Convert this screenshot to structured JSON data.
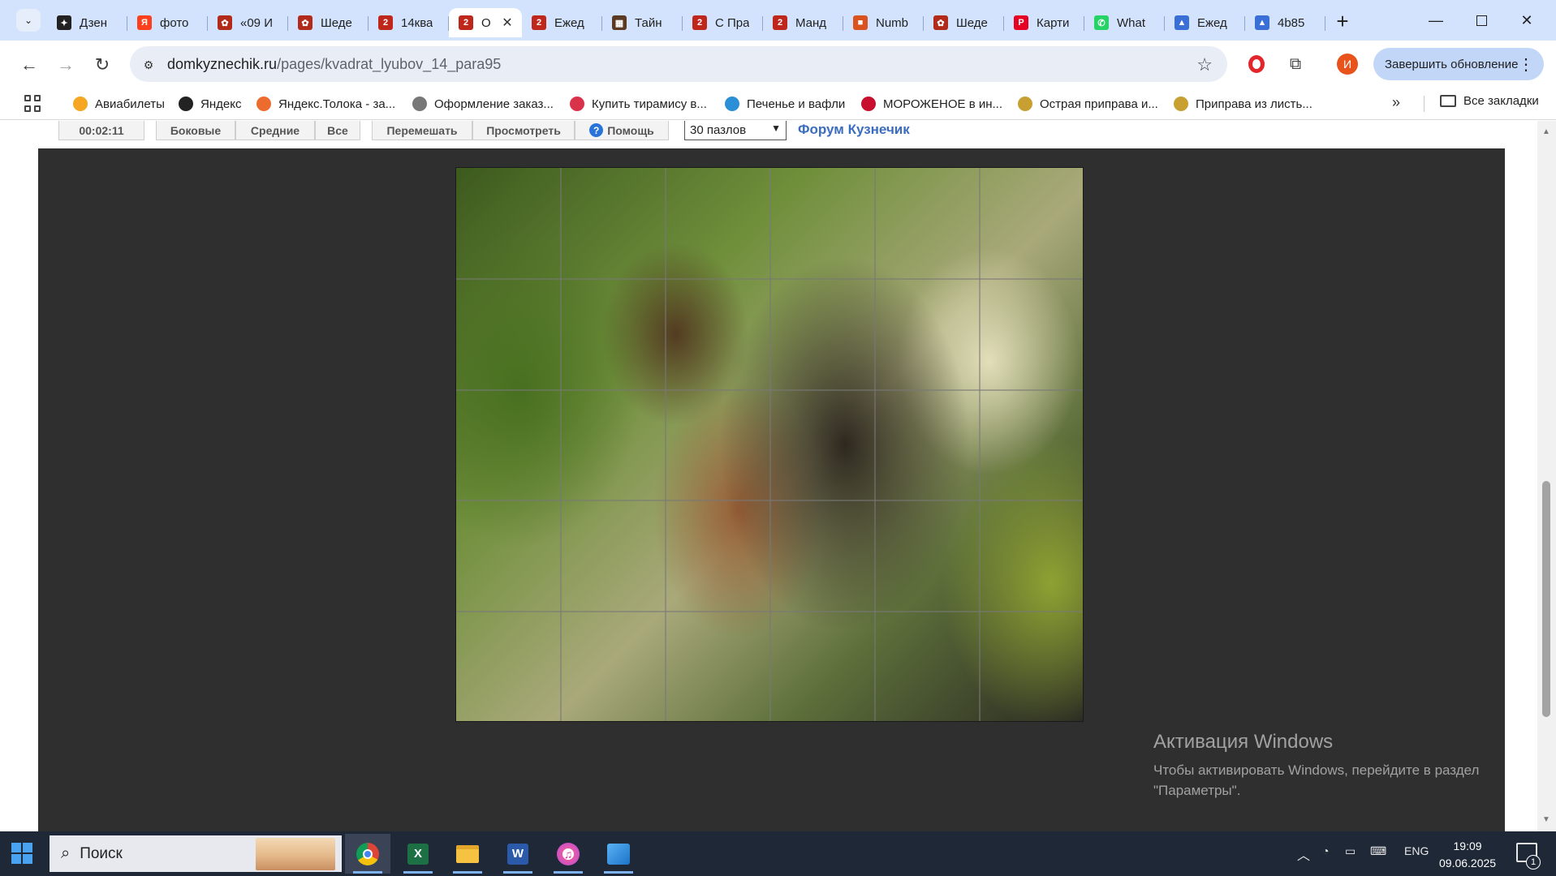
{
  "browser": {
    "tabs": [
      {
        "label": "Дзен",
        "icon": "dzen-icon",
        "color": "#222222",
        "glyph": "✦"
      },
      {
        "label": "фото",
        "icon": "yandex-icon",
        "color": "#fc3f1d",
        "glyph": "Я"
      },
      {
        "label": "«09 И",
        "icon": "puzzle-site-icon",
        "color": "#b12a1a",
        "glyph": "✿"
      },
      {
        "label": "Шеде",
        "icon": "puzzle-site-icon",
        "color": "#b12a1a",
        "glyph": "✿"
      },
      {
        "label": "14ква",
        "icon": "puzzle-badge-icon",
        "color": "#c0271c",
        "glyph": "2"
      },
      {
        "label": "О",
        "icon": "puzzle-badge-icon",
        "color": "#c0271c",
        "glyph": "2",
        "active": true
      },
      {
        "label": "Ежед",
        "icon": "puzzle-badge-icon",
        "color": "#c0271c",
        "glyph": "2"
      },
      {
        "label": "Тайн",
        "icon": "puzzle-site-icon",
        "color": "#5a3a22",
        "glyph": "▦"
      },
      {
        "label": "С Пра",
        "icon": "puzzle-badge-icon",
        "color": "#c0271c",
        "glyph": "2"
      },
      {
        "label": "Манд",
        "icon": "puzzle-badge-icon",
        "color": "#c0271c",
        "glyph": "2"
      },
      {
        "label": "Numb",
        "icon": "numbers-icon",
        "color": "#d9531e",
        "glyph": "■"
      },
      {
        "label": "Шеде",
        "icon": "puzzle-site-icon",
        "color": "#b12a1a",
        "glyph": "✿"
      },
      {
        "label": "Карти",
        "icon": "pinterest-icon",
        "color": "#e60023",
        "glyph": "P"
      },
      {
        "label": "What",
        "icon": "whatsapp-icon",
        "color": "#25d366",
        "glyph": "✆"
      },
      {
        "label": "Ежед",
        "icon": "docs-icon",
        "color": "#3b6fd8",
        "glyph": "▲"
      },
      {
        "label": "4b85",
        "icon": "docs-icon",
        "color": "#3b6fd8",
        "glyph": "▲"
      }
    ],
    "close_tab_glyph": "✕",
    "new_tab_glyph": "+",
    "url_host": "domkyznechik.ru",
    "url_path": "/pages/kvadrat_lyubov_14_para95",
    "update_label": "Завершить обновление",
    "profile_initial": "И",
    "bookmarks": [
      {
        "label": "Авиабилеты",
        "icon": "plane-icon",
        "color": "#f5a623"
      },
      {
        "label": "Яндекс",
        "icon": "yandex-star-icon",
        "color": "#222222"
      },
      {
        "label": "Яндекс.Толока - за...",
        "icon": "toloka-icon",
        "color": "#ee6b2f"
      },
      {
        "label": "Оформление заказ...",
        "icon": "globe-icon",
        "color": "#777777"
      },
      {
        "label": "Купить тирамису в...",
        "icon": "tiramisu-icon",
        "color": "#d8334a"
      },
      {
        "label": "Печенье и вафли",
        "icon": "cookie-icon",
        "color": "#2a8fd6"
      },
      {
        "label": "МОРОЖЕНОЕ в ин...",
        "icon": "shop-icon",
        "color": "#c8102e"
      },
      {
        "label": "Острая приправа и...",
        "icon": "spice-icon",
        "color": "#c8a032"
      },
      {
        "label": "Приправа из листь...",
        "icon": "herb-icon",
        "color": "#c8a032"
      }
    ],
    "all_bookmarks_label": "Все закладки"
  },
  "game": {
    "timer": "00:02:11",
    "buttons": [
      "Боковые",
      "Средние",
      "Все",
      "Перемешать",
      "Просмотреть",
      "Помощь"
    ],
    "pieces_select": "30 пазлов",
    "forum_link": "Форум Кузнечик",
    "puzzle_cols": 6,
    "puzzle_rows": 5
  },
  "watermark": {
    "title": "Активация Windows",
    "line1": "Чтобы активировать Windows, перейдите в раздел",
    "line2": "\"Параметры\"."
  },
  "taskbar": {
    "search_placeholder": "Поиск",
    "apps": [
      "chrome-icon",
      "excel-icon",
      "file-explorer-icon",
      "word-icon",
      "itunes-icon",
      "photos-icon"
    ],
    "language": "ENG",
    "time": "19:09",
    "date": "09.06.2025",
    "notifications": "1"
  }
}
